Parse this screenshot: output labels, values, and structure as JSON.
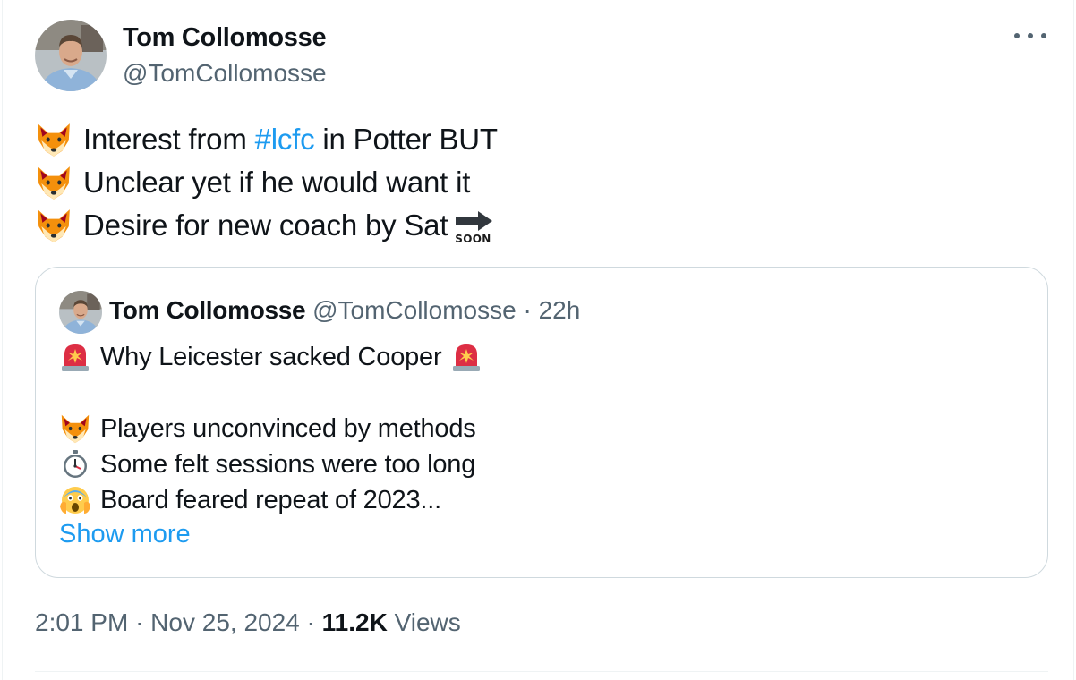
{
  "author": {
    "display_name": "Tom Collomosse",
    "handle": "@TomCollomosse"
  },
  "tweet": {
    "lines": [
      {
        "emoji": "fox-icon",
        "before": "Interest from ",
        "hashtag": "#lcfc",
        "after": " in Potter BUT"
      },
      {
        "emoji": "fox-icon",
        "text": "Unclear yet if he would want it"
      },
      {
        "emoji": "fox-icon",
        "text": "Desire for new coach by Sat",
        "trailing_emoji": "soon-arrow-icon",
        "trailing_label": "SOON"
      }
    ]
  },
  "quoted": {
    "display_name": "Tom Collomosse",
    "handle": "@TomCollomosse",
    "separator": "·",
    "time": "22h",
    "headline": "Why Leicester sacked Cooper",
    "headline_emoji": "police-light-icon",
    "items": [
      {
        "emoji": "fox-icon",
        "text": "Players unconvinced by methods"
      },
      {
        "emoji": "stopwatch-icon",
        "text": "Some felt sessions were too long"
      },
      {
        "emoji": "screaming-face-icon",
        "text": "Board feared repeat of 2023..."
      }
    ],
    "show_more": "Show more"
  },
  "meta": {
    "time": "2:01 PM",
    "separator": "·",
    "date": "Nov 25, 2024",
    "views_count": "11.2K",
    "views_label": "Views"
  },
  "colors": {
    "link": "#1d9bf0",
    "secondary_text": "#536471",
    "border": "#cfd9de"
  }
}
